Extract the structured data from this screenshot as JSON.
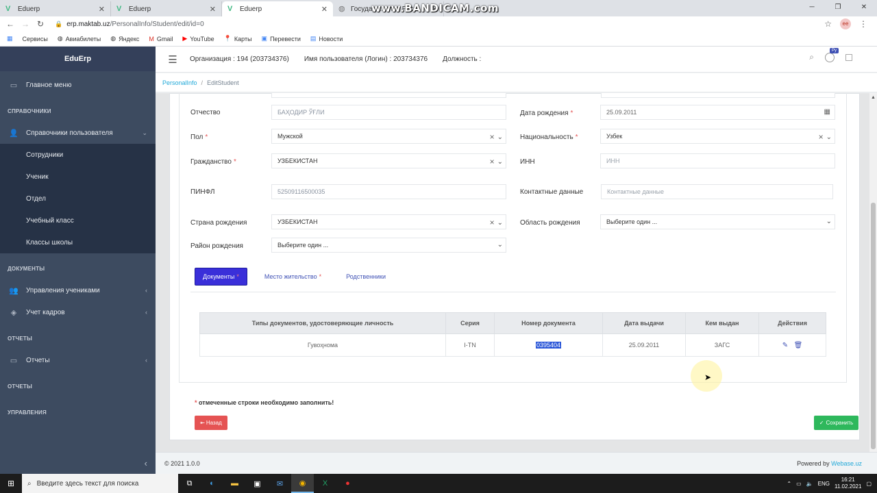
{
  "browser": {
    "tabs": [
      {
        "title": "Eduerp",
        "icon": "vue-icon"
      },
      {
        "title": "Eduerp",
        "icon": "vue-icon"
      },
      {
        "title": "Eduerp",
        "icon": "vue-icon",
        "active": true
      },
      {
        "title": "Государ...митет Респ",
        "icon": "globe-icon"
      }
    ],
    "watermark": "www.BANDICAM.com",
    "url_host": "erp.maktab.uz",
    "url_path": "/PersonalInfo/Student/edit/id=0",
    "bookmarks": [
      "Сервисы",
      "Авиабилеты",
      "Яндекс",
      "Gmail",
      "YouTube",
      "Карты",
      "Перевести",
      "Новости"
    ]
  },
  "sidebar": {
    "brand": "EduErp",
    "main_menu": "Главное меню",
    "section_directories": "СПРАВОЧНИКИ",
    "user_directories": "Справочники пользователя",
    "sub_items": [
      "Сотрудники",
      "Ученик",
      "Отдел",
      "Учебный класс",
      "Классы школы"
    ],
    "section_documents": "ДОКУМЕНТЫ",
    "student_management": "Управления учениками",
    "hr_accounting": "Учет кадров",
    "section_reports_1": "ОТЧЕТЫ",
    "reports": "Отчеты",
    "section_reports_2": "ОТЧЕТЫ",
    "section_management": "УПРАВЛЕНИЯ"
  },
  "header": {
    "organization": "Организация : 194 (203734376)",
    "username": "Имя пользователя (Логин) : 203734376",
    "position": "Должность :",
    "lang_badge": "Ру"
  },
  "breadcrumb": {
    "link": "PersonalInfo",
    "current": "EditStudent"
  },
  "form": {
    "patronymic_label": "Отчество",
    "patronymic_value": "БАҲОДИР ЎҒЛИ",
    "birth_date_label": "Дата рождения",
    "birth_date_value": "25.09.2011",
    "gender_label": "Пол",
    "gender_value": "Мужской",
    "nationality_label": "Национальность",
    "nationality_value": "Узбек",
    "citizenship_label": "Гражданство",
    "citizenship_value": "УЗБЕКИСТАН",
    "inn_label": "ИНН",
    "inn_placeholder": "ИНН",
    "pinfl_label": "ПИНФЛ",
    "pinfl_value": "52509116500035",
    "contacts_label": "Контактные данные",
    "contacts_placeholder": "Контактные данные",
    "birth_country_label": "Страна рождения",
    "birth_country_value": "УЗБЕКИСТАН",
    "birth_region_label": "Область рождения",
    "birth_region_value": "Выберите один ...",
    "birth_district_label": "Район рождения",
    "birth_district_value": "Выберите один ...",
    "required_mark": "*"
  },
  "tabs": {
    "documents": "Документы",
    "residence": "Место жительство",
    "relatives": "Родственники"
  },
  "documents_table": {
    "headers": [
      "Типы документов, удостоверяющие личность",
      "Серия",
      "Номер документа",
      "Дата выдачи",
      "Кем выдан",
      "Действия"
    ],
    "rows": [
      [
        "Гувоҳнома",
        "I-TN",
        "0395404",
        "25.09.2011",
        "ЗАГС"
      ]
    ]
  },
  "note": {
    "star": "*",
    "text": " отмеченные строки необходимо заполнить!"
  },
  "buttons": {
    "back": "Назад",
    "save": "Сохранить"
  },
  "footer": {
    "copyright": "© 2021 1.0.0",
    "powered": "Powered by",
    "powered_link": "Webase.uz"
  },
  "taskbar": {
    "search_placeholder": "Введите здесь текст для поиска",
    "lang": "ENG",
    "time": "16:21",
    "date": "11.02.2021"
  }
}
